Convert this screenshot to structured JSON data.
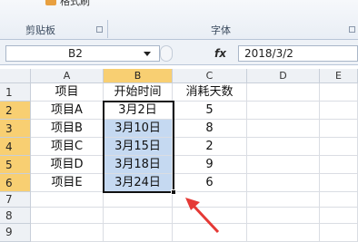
{
  "ribbon": {
    "clipboard_label": "剪贴板",
    "font_label": "字体",
    "top_partial_label": "格式刷"
  },
  "formula_bar": {
    "name_box": "B2",
    "fx": "fx",
    "value": "2018/3/2"
  },
  "columns": [
    "A",
    "B",
    "C",
    "D",
    "E"
  ],
  "rows": [
    {
      "num": "1",
      "a": "项目",
      "b": "开始时间",
      "c": "消耗天数"
    },
    {
      "num": "2",
      "a": "项目A",
      "b": "3月2日",
      "c": "5"
    },
    {
      "num": "3",
      "a": "项目B",
      "b": "3月10日",
      "c": "8"
    },
    {
      "num": "4",
      "a": "项目C",
      "b": "3月15日",
      "c": "2"
    },
    {
      "num": "5",
      "a": "项目D",
      "b": "3月18日",
      "c": "9"
    },
    {
      "num": "6",
      "a": "项目E",
      "b": "3月24日",
      "c": "6"
    },
    {
      "num": "7",
      "a": "",
      "b": "",
      "c": ""
    },
    {
      "num": "8",
      "a": "",
      "b": "",
      "c": ""
    },
    {
      "num": "9",
      "a": "",
      "b": "",
      "c": ""
    }
  ],
  "colors": {
    "selection_fill": "#c5d9f1",
    "header_highlight": "#f8cf72",
    "arrow": "#e53935"
  }
}
